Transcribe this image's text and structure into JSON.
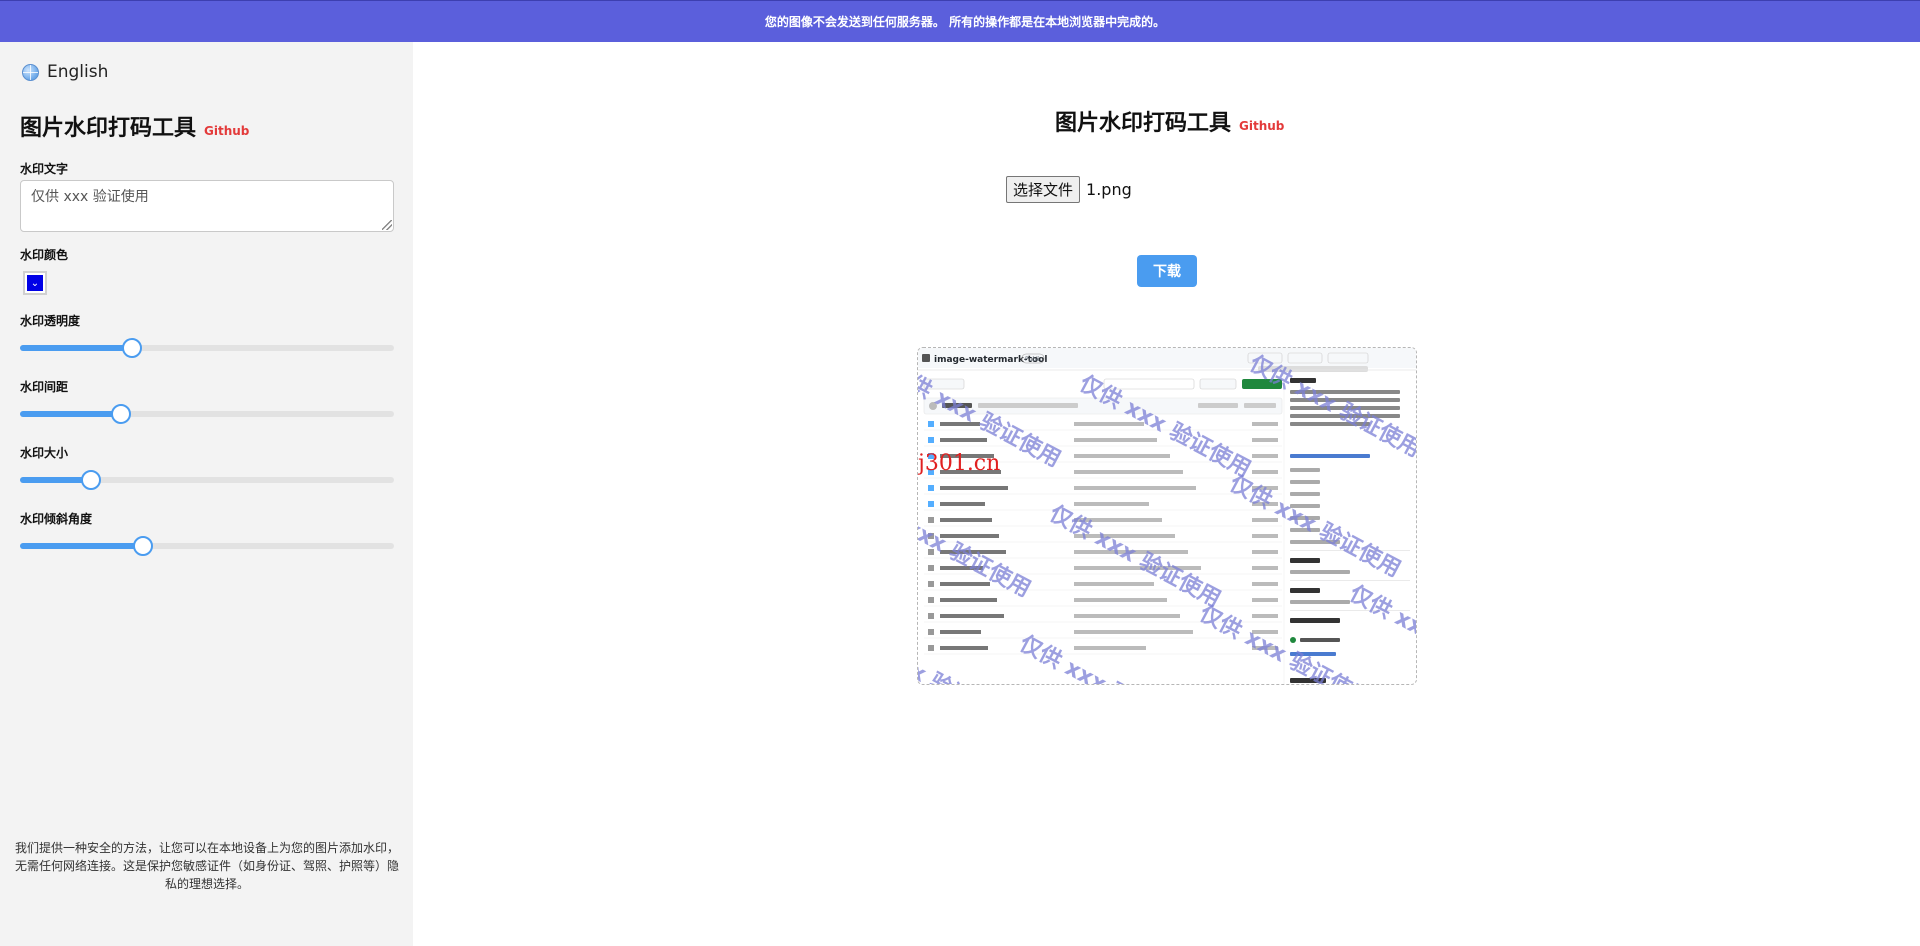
{
  "banner": {
    "text": "您的图像不会发送到任何服务器。 所有的操作都是在本地浏览器中完成的。"
  },
  "sidebar": {
    "language": "English",
    "title": "图片水印打码工具",
    "github_link": "Github",
    "watermark_text": {
      "label": "水印文字",
      "value": "仅供 xxx 验证使用"
    },
    "watermark_color": {
      "label": "水印颜色",
      "color": "#0000e6"
    },
    "sliders": [
      {
        "label": "水印透明度",
        "percent": 30
      },
      {
        "label": "水印间距",
        "percent": 27
      },
      {
        "label": "水印大小",
        "percent": 19
      },
      {
        "label": "水印倾斜角度",
        "percent": 33
      }
    ],
    "footer_note": "我们提供一种安全的方法，让您可以在本地设备上为您的图片添加水印，无需任何网络连接。这是保护您敏感证件（如身份证、驾照、护照等）隐私的理想选择。"
  },
  "main": {
    "title": "图片水印打码工具",
    "github_link": "Github",
    "file_button": "选择文件",
    "file_name": "1.png",
    "download_button": "下载",
    "preview": {
      "watermark_text": "仅供 xxx 验证使用",
      "overlay_text": "j301.cn",
      "overlay_color": "#e02020",
      "watermark_color": "#7b7fd6",
      "repo_name": "image-watermark-tool",
      "repo_visibility": "Public"
    }
  },
  "colors": {
    "accent": "#4a9cf0",
    "banner": "#5b5fdc",
    "github_red": "#e33a3a"
  }
}
